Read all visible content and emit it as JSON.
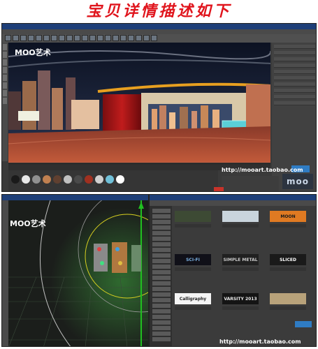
{
  "banner": {
    "text": "宝贝详情描述如下"
  },
  "panel_top": {
    "watermark": "MOO艺术",
    "url": "http://mooart.taobao.com",
    "logo": "moo",
    "badge": "",
    "title_bar": ""
  },
  "panel_bottom_left": {
    "watermark": "MOO艺术"
  },
  "panel_bottom_right": {
    "url": "http://mooart.taobao.com",
    "badge": "",
    "thumbnails": [
      {
        "text": "",
        "bg": "#3d4a34",
        "fg": "#b9d07a"
      },
      {
        "text": "",
        "bg": "#c9d4dc",
        "fg": "#506070"
      },
      {
        "text": "MOON",
        "bg": "#e07a22",
        "fg": "#1a1a1a"
      },
      {
        "text": "SCI-FI",
        "bg": "#101018",
        "fg": "#7ab0e0"
      },
      {
        "text": "SIMPLE METAL",
        "bg": "#202020",
        "fg": "#c8c8c8"
      },
      {
        "text": "SLICED",
        "bg": "#1a1a1a",
        "fg": "#ffffff"
      },
      {
        "text": "Calligraphy",
        "bg": "#f4f4f4",
        "fg": "#222222"
      },
      {
        "text": "VARSITY 2013",
        "bg": "#141414",
        "fg": "#e8e8e8"
      },
      {
        "text": "",
        "bg": "#b8a27a",
        "fg": "#503820"
      }
    ]
  },
  "colors": {
    "banner_red": "#e0141c",
    "title_blue": "#1e3f78",
    "badge_blue": "#2f7cc4",
    "ui_gray": "#3a3a3a"
  }
}
